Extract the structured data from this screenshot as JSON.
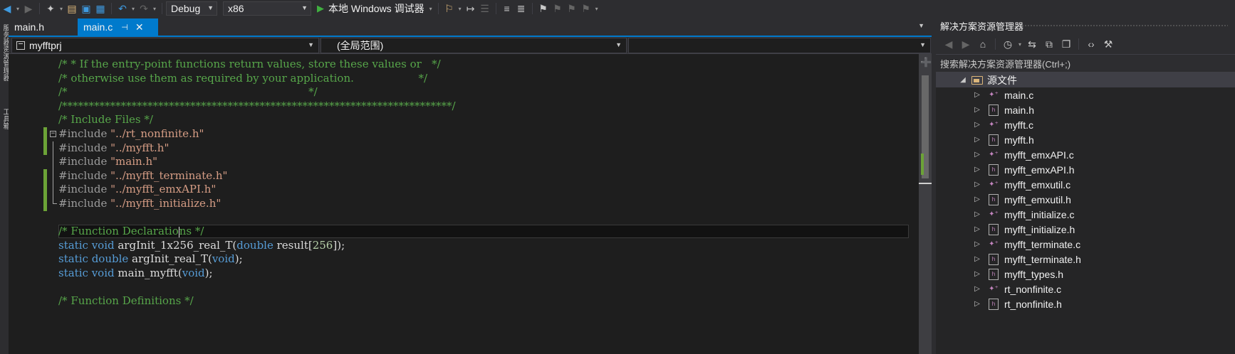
{
  "toolbar": {
    "config": "Debug",
    "platform": "x86",
    "run_label": "本地 Windows 调试器"
  },
  "left_strip": {
    "item1": "服务器资源管理器",
    "item2": "工具箱"
  },
  "tabs": [
    {
      "label": "main.h",
      "active": false
    },
    {
      "label": "main.c",
      "active": true
    }
  ],
  "navbar": {
    "project": "myfftprj",
    "scope": "(全局范围)",
    "member": ""
  },
  "code_lines": [
    "/* * If the entry-point functions return values, store these values or   */",
    "/* otherwise use them as required by your application.                   */",
    "/*                                                                       */",
    "/*************************************************************************/",
    "/* Include Files */",
    "#include \"../rt_nonfinite.h\"",
    "#include \"../myfft.h\"",
    "#include \"main.h\"",
    "#include \"../myfft_terminate.h\"",
    "#include \"../myfft_emxAPI.h\"",
    "#include \"../myfft_initialize.h\"",
    "",
    "/* Function Declarations */",
    "static void argInit_1x256_real_T(double result[256]);",
    "static double argInit_real_T(void);",
    "static void main_myfft(void);",
    "",
    "/* Function Definitions */"
  ],
  "solution_explorer": {
    "title": "解决方案资源管理器",
    "search_placeholder": "搜索解决方案资源管理器(Ctrl+;)",
    "folder": "源文件",
    "files": [
      {
        "name": "main.c",
        "kind": "c"
      },
      {
        "name": "main.h",
        "kind": "h"
      },
      {
        "name": "myfft.c",
        "kind": "c"
      },
      {
        "name": "myfft.h",
        "kind": "h"
      },
      {
        "name": "myfft_emxAPI.c",
        "kind": "c"
      },
      {
        "name": "myfft_emxAPI.h",
        "kind": "h"
      },
      {
        "name": "myfft_emxutil.c",
        "kind": "c"
      },
      {
        "name": "myfft_emxutil.h",
        "kind": "h"
      },
      {
        "name": "myfft_initialize.c",
        "kind": "c"
      },
      {
        "name": "myfft_initialize.h",
        "kind": "h"
      },
      {
        "name": "myfft_terminate.c",
        "kind": "c"
      },
      {
        "name": "myfft_terminate.h",
        "kind": "h"
      },
      {
        "name": "myfft_types.h",
        "kind": "h"
      },
      {
        "name": "rt_nonfinite.c",
        "kind": "c"
      },
      {
        "name": "rt_nonfinite.h",
        "kind": "h"
      }
    ]
  },
  "colors": {
    "accent": "#007acc",
    "comment": "#57a64a",
    "keyword": "#569cd6",
    "string": "#d69d85",
    "number": "#b5cea8",
    "change_bar": "#6ca337"
  }
}
